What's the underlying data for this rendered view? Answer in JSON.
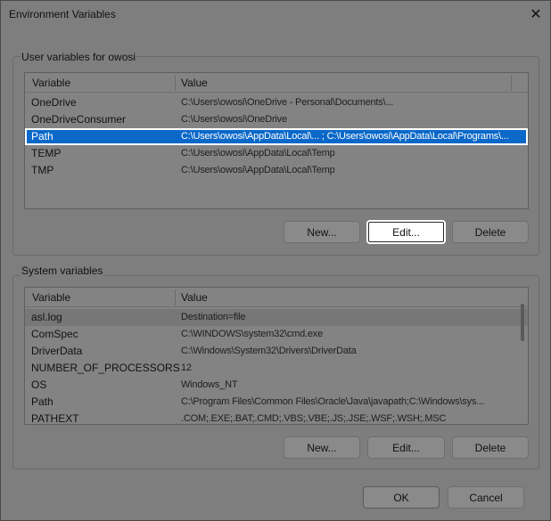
{
  "window": {
    "title": "Environment Variables",
    "close_icon": "✕"
  },
  "user_vars": {
    "group_label": "User variables for owosi",
    "col_variable": "Variable",
    "col_value": "Value",
    "rows": [
      {
        "name": "OneDrive",
        "value": "C:\\Users\\owosi\\OneDrive - Personal\\Documents\\..."
      },
      {
        "name": "OneDriveConsumer",
        "value": "C:\\Users\\owosi\\OneDrive"
      },
      {
        "name": "Path",
        "value": "C:\\Users\\owosi\\AppData\\Local\\... ; C:\\Users\\owosi\\AppData\\Local\\Programs\\..."
      },
      {
        "name": "TEMP",
        "value": "C:\\Users\\owosi\\AppData\\Local\\Temp"
      },
      {
        "name": "TMP",
        "value": "C:\\Users\\owosi\\AppData\\Local\\Temp"
      }
    ],
    "btn_new": "New...",
    "btn_edit": "Edit...",
    "btn_delete": "Delete"
  },
  "system_vars": {
    "group_label": "System variables",
    "col_variable": "Variable",
    "col_value": "Value",
    "rows": [
      {
        "name": "asl.log",
        "value": "Destination=file"
      },
      {
        "name": "ComSpec",
        "value": "C:\\WINDOWS\\system32\\cmd.exe"
      },
      {
        "name": "DriverData",
        "value": "C:\\Windows\\System32\\Drivers\\DriverData"
      },
      {
        "name": "NUMBER_OF_PROCESSORS",
        "value": "12"
      },
      {
        "name": "OS",
        "value": "Windows_NT"
      },
      {
        "name": "Path",
        "value": "C:\\Program Files\\Common Files\\Oracle\\Java\\javapath;C:\\Windows\\sys..."
      },
      {
        "name": "PATHEXT",
        "value": ".COM;.EXE;.BAT;.CMD;.VBS;.VBE;.JS;.JSE;.WSF;.WSH;.MSC"
      }
    ],
    "btn_new": "New...",
    "btn_edit": "Edit...",
    "btn_delete": "Delete"
  },
  "footer": {
    "btn_ok": "OK",
    "btn_cancel": "Cancel"
  }
}
